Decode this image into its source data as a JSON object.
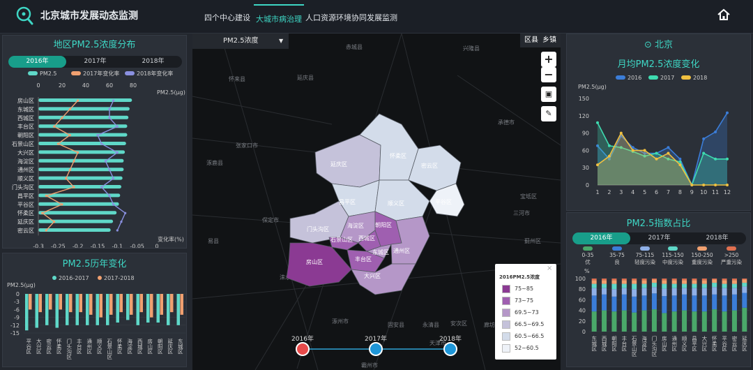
{
  "app": {
    "title": "北京城市发展动态监测"
  },
  "nav": [
    "四个中心建设",
    "大城市病治理",
    "人口资源环境协同发展监测"
  ],
  "left1": {
    "title": "地区PM2.5浓度分布",
    "tabs": [
      "2016年",
      "2017年",
      "2018年"
    ],
    "legend": [
      "PM2.5",
      "2017年变化率",
      "2018年变化率"
    ],
    "unit_top": "PM2.5(μg)",
    "unit_bottom": "变化率(%)",
    "chart_data": {
      "type": "bar",
      "categories": [
        "房山区",
        "东城区",
        "西城区",
        "丰台区",
        "朝阳区",
        "石景山区",
        "大兴区",
        "海淀区",
        "通州区",
        "顺义区",
        "门头沟区",
        "昌平区",
        "平谷区",
        "怀柔区",
        "延庆区",
        "密云区"
      ],
      "values": [
        79,
        77,
        76,
        75,
        75,
        74,
        73,
        72,
        72,
        71,
        70,
        69,
        68,
        66,
        63,
        61
      ],
      "series": [
        {
          "name": "2017年变化率",
          "values": [
            -0.2,
            -0.22,
            -0.24,
            -0.26,
            -0.22,
            -0.25,
            -0.2,
            -0.21,
            -0.22,
            -0.23,
            -0.21,
            -0.28,
            -0.24,
            -0.29,
            -0.26,
            -0.28
          ]
        },
        {
          "name": "2018年变化率",
          "values": [
            -0.11,
            -0.12,
            -0.12,
            -0.1,
            -0.15,
            -0.14,
            -0.1,
            -0.13,
            -0.12,
            -0.11,
            -0.14,
            -0.12,
            -0.11,
            -0.08,
            -0.09,
            -0.1
          ]
        }
      ],
      "top_axis": {
        "ticks": [
          0,
          20,
          40,
          60,
          80
        ],
        "range": [
          0,
          100
        ]
      },
      "bottom_axis": {
        "ticks": [
          -0.3,
          -0.25,
          -0.2,
          -0.15,
          -0.1,
          -0.05,
          0
        ],
        "range": [
          -0.3,
          0
        ]
      },
      "colors": [
        "#5fd8c8",
        "#f0a070",
        "#8a90e0"
      ]
    }
  },
  "left2": {
    "title": "PM2.5历年变化",
    "unit": "PM2.5(μg)",
    "legend": [
      "2016-2017",
      "2017-2018"
    ],
    "chart_data": {
      "type": "bar",
      "categories": [
        "平谷区",
        "大兴区",
        "密云区",
        "怀柔区",
        "门头沟区",
        "丰台区",
        "通州区",
        "顺义区",
        "石景山区",
        "怀柔区",
        "海淀区",
        "西城区",
        "房山区",
        "朝阳区",
        "延庆区",
        "东城区"
      ],
      "series": [
        {
          "name": "2016-2017",
          "values": [
            -14,
            -13,
            -12,
            -13,
            -12,
            -12,
            -12,
            -12,
            -12,
            -11,
            -10,
            -12,
            -11,
            -11,
            -12,
            -12
          ]
        },
        {
          "name": "2017-2018",
          "values": [
            -6,
            -7,
            -6,
            -6,
            -7,
            -7,
            -8,
            -9,
            -8,
            -7,
            -8,
            -7,
            -9,
            -8,
            -7,
            -8
          ]
        }
      ],
      "yticks": [
        0,
        -3,
        -6,
        -9,
        -12,
        -15
      ],
      "ylim": [
        -15,
        0
      ],
      "colors": [
        "#5fd8c8",
        "#f0a070"
      ]
    }
  },
  "map": {
    "metric": "PM2.5浓度",
    "view_toggle": [
      "区县",
      "乡镇"
    ],
    "districts": [
      "延庆区",
      "怀柔区",
      "密云区",
      "昌平区",
      "平谷区",
      "顺义区",
      "门头沟区",
      "海淀区",
      "朝阳区",
      "石景山区",
      "西城区",
      "东城区",
      "丰台区",
      "通州区",
      "房山区",
      "大兴区"
    ],
    "places": [
      "怀来县",
      "延庆县",
      "兴隆县",
      "赤城县",
      "张家口市",
      "承德市",
      "涿鹿县",
      "涞水县",
      "易县",
      "涿州市",
      "廊坊市",
      "天津市",
      "宝坻区",
      "蓟州区",
      "保定市",
      "沧州市",
      "霸州市",
      "固安县",
      "永清县",
      "安次区",
      "三河市"
    ],
    "timeline": [
      "2016年",
      "2017年",
      "2018年"
    ],
    "legend": {
      "title": "2016PM2.5浓度",
      "items": [
        "75~85",
        "73~75",
        "69.5~73",
        "66.5~69.5",
        "60.5~66.5",
        "52~60.5"
      ],
      "colors": [
        "#8b3a93",
        "#9f5fb0",
        "#b597c8",
        "#c5c2da",
        "#d3dcea",
        "#eef2f8"
      ]
    }
  },
  "right1": {
    "location": "北京",
    "title": "月均PM2.5浓度变化",
    "unit": "PM2.5(μg)",
    "chart_data": {
      "type": "area",
      "x": [
        1,
        2,
        3,
        4,
        5,
        6,
        7,
        8,
        9,
        10,
        11,
        12
      ],
      "series": [
        {
          "name": "2016",
          "values": [
            68,
            45,
            85,
            65,
            55,
            55,
            65,
            45,
            0,
            80,
            92,
            125
          ],
          "color": "#3b7dd8"
        },
        {
          "name": "2017",
          "values": [
            108,
            68,
            65,
            58,
            50,
            55,
            45,
            40,
            0,
            55,
            45,
            45
          ],
          "color": "#3edbb0"
        },
        {
          "name": "2018",
          "values": [
            35,
            50,
            90,
            60,
            60,
            45,
            55,
            35,
            0,
            0,
            0,
            0
          ],
          "color": "#f0c040"
        }
      ],
      "yticks": [
        0,
        30,
        60,
        90,
        120,
        150
      ],
      "ylim": [
        0,
        150
      ]
    }
  },
  "right2": {
    "title": "PM2.5指数占比",
    "tabs": [
      "2016年",
      "2017年",
      "2018年"
    ],
    "unit": "%",
    "legend": [
      {
        "range": "0-35",
        "label": "优",
        "color": "#4aa86a"
      },
      {
        "range": "35-75",
        "label": "良",
        "color": "#3b7dd8"
      },
      {
        "range": "75-115",
        "label": "轻度污染",
        "color": "#8fb0e8"
      },
      {
        "range": "115-150",
        "label": "中度污染",
        "color": "#5fd8c8"
      },
      {
        "range": "150-250",
        "label": "重度污染",
        "color": "#f0a070"
      },
      {
        "range": ">250",
        "label": "严重污染",
        "color": "#e07050"
      }
    ],
    "chart_data": {
      "type": "bar",
      "categories": [
        "东城区",
        "西城区",
        "朝阳区",
        "丰台区",
        "石景山区",
        "海淀区",
        "门头沟区",
        "房山区",
        "通州区",
        "顺义区",
        "昌平区",
        "大兴区",
        "怀柔区",
        "平谷区",
        "密云区",
        "延庆区"
      ],
      "series": [
        {
          "name": "优",
          "values": [
            38,
            40,
            38,
            40,
            36,
            40,
            42,
            35,
            38,
            40,
            38,
            38,
            42,
            38,
            40,
            45
          ]
        },
        {
          "name": "良",
          "values": [
            30,
            30,
            28,
            30,
            30,
            28,
            30,
            32,
            30,
            30,
            30,
            30,
            28,
            30,
            30,
            28
          ]
        },
        {
          "name": "轻度污染",
          "values": [
            14,
            12,
            14,
            12,
            14,
            14,
            12,
            14,
            14,
            12,
            14,
            14,
            14,
            14,
            12,
            12
          ]
        },
        {
          "name": "中度污染",
          "values": [
            8,
            8,
            10,
            8,
            10,
            8,
            8,
            9,
            8,
            8,
            8,
            8,
            8,
            8,
            8,
            7
          ]
        },
        {
          "name": "重度污染",
          "values": [
            7,
            7,
            7,
            7,
            7,
            7,
            6,
            7,
            7,
            7,
            7,
            7,
            6,
            7,
            7,
            6
          ]
        },
        {
          "name": "严重污染",
          "values": [
            3,
            3,
            3,
            3,
            3,
            3,
            2,
            3,
            3,
            3,
            3,
            3,
            2,
            3,
            3,
            2
          ]
        }
      ],
      "yticks": [
        0,
        20,
        40,
        60,
        80,
        100
      ],
      "ylim": [
        0,
        100
      ]
    }
  }
}
